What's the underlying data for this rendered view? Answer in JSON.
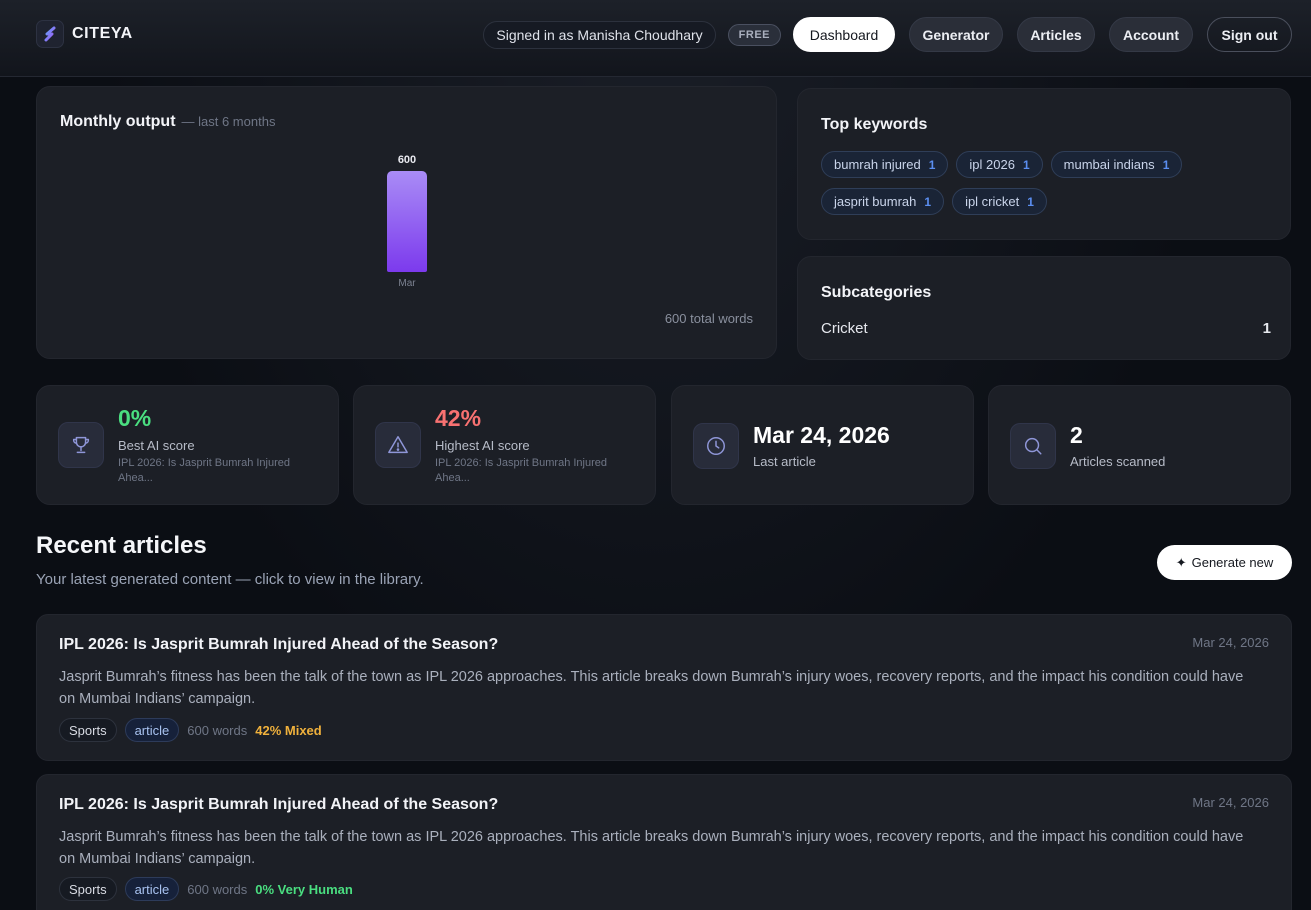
{
  "brand": {
    "name": "CITEYA"
  },
  "header": {
    "signed_in": "Signed in as Manisha Choudhary",
    "plan": "FREE",
    "nav": [
      "Dashboard",
      "Generator",
      "Articles",
      "Account",
      "Sign out"
    ]
  },
  "monthly_output": {
    "title": "Monthly output",
    "subtitle": "— last 6 months",
    "total": "600 total words"
  },
  "chart_data": {
    "type": "bar",
    "categories": [
      "Mar"
    ],
    "values": [
      600
    ],
    "value_labels": [
      "600"
    ],
    "bar_color": "#7c3aed"
  },
  "top_keywords": {
    "title": "Top keywords",
    "items": [
      {
        "label": "bumrah injured",
        "count": "1"
      },
      {
        "label": "ipl 2026",
        "count": "1"
      },
      {
        "label": "mumbai indians",
        "count": "1"
      },
      {
        "label": "jasprit bumrah",
        "count": "1"
      },
      {
        "label": "ipl cricket",
        "count": "1"
      }
    ]
  },
  "subcategories": {
    "title": "Subcategories",
    "items": [
      {
        "label": "Cricket",
        "count": "1"
      }
    ]
  },
  "stats": [
    {
      "icon": "trophy-icon",
      "value": "0%",
      "label": "Best AI score",
      "note": "IPL 2026: Is Jasprit Bumrah Injured Ahea...",
      "color": "#4ade80"
    },
    {
      "icon": "warning-icon",
      "value": "42%",
      "label": "Highest AI score",
      "note": "IPL 2026: Is Jasprit Bumrah Injured Ahea...",
      "color": "#f87171"
    },
    {
      "icon": "clock-icon",
      "value": "Mar 24, 2026",
      "label": "Last article",
      "note": "",
      "color": "#ffffff"
    },
    {
      "icon": "search-icon",
      "value": "2",
      "label": "Articles scanned",
      "note": "",
      "color": "#ffffff"
    }
  ],
  "recent": {
    "title": "Recent articles",
    "subtitle": "Your latest generated content — click to view in the library.",
    "generate_label": "Generate new",
    "generate_glyph": "✦",
    "articles": [
      {
        "title": "IPL 2026: Is Jasprit Bumrah Injured Ahead of the Season?",
        "date": "Mar 24, 2026",
        "excerpt": "Jasprit Bumrah’s fitness has been the talk of the town as IPL 2026 approaches. This article breaks down Bumrah’s injury woes, recovery reports, and the impact his condition could have on Mumbai Indians’ campaign.",
        "category": "Sports",
        "type": "article",
        "words": "600 words",
        "score": "42% Mixed",
        "score_color": "#f0b13c"
      },
      {
        "title": "IPL 2026: Is Jasprit Bumrah Injured Ahead of the Season?",
        "date": "Mar 24, 2026",
        "excerpt": "Jasprit Bumrah’s fitness has been the talk of the town as IPL 2026 approaches. This article breaks down Bumrah’s injury woes, recovery reports, and the impact his condition could have on Mumbai Indians’ campaign.",
        "category": "Sports",
        "type": "article",
        "words": "600 words",
        "score": "0% Very Human",
        "score_color": "#4ade80"
      }
    ]
  }
}
